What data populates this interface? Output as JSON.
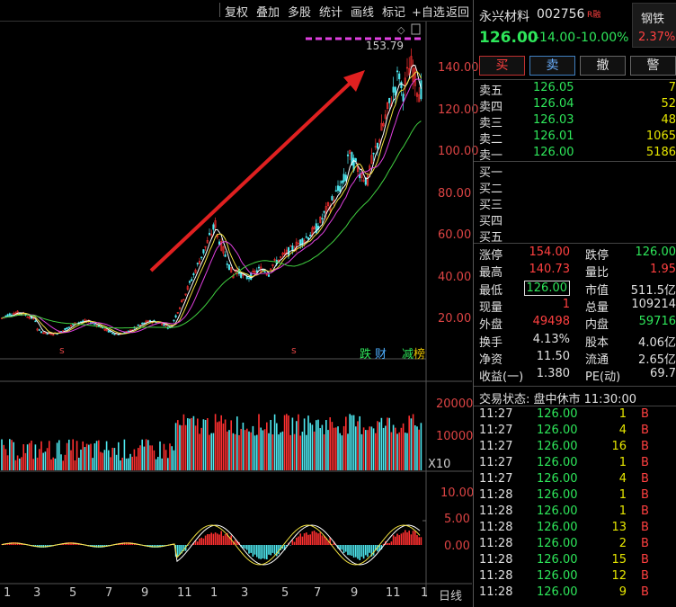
{
  "toolbar": {
    "items": [
      "复权",
      "叠加",
      "多股",
      "统计",
      "画线",
      "标记",
      "+自选",
      "返回"
    ]
  },
  "chart": {
    "price_axis": [
      "140.00",
      "120.00",
      "100.00",
      "80.00",
      "60.00",
      "40.00",
      "20.00"
    ],
    "peak_label": "153.79",
    "markers": [
      "跌",
      "财",
      "减",
      "榜"
    ],
    "s_marks": [
      "s",
      "s"
    ],
    "vol_axis": [
      "20000",
      "10000",
      "X10"
    ],
    "macd_axis": [
      "10.00",
      "5.00",
      "0.00"
    ],
    "month_labels": [
      "1",
      "3",
      "5",
      "7",
      "9",
      "11",
      "1",
      "3",
      "5",
      "7",
      "9",
      "11",
      "1"
    ],
    "period": "日线",
    "colors": {
      "up": "#ff3030",
      "down": "#4ee8f0",
      "ma_white": "#ffffff",
      "ma_yellow": "#f0e040",
      "ma_purple": "#e040e0",
      "ma_green": "#40d040",
      "arrow": "#e02020"
    }
  },
  "panel": {
    "name": "永兴材料",
    "code": "002756",
    "badge": "R融",
    "sector": "钢铁",
    "price": "126.00",
    "change": "-14.00",
    "change_pct": "-10.00%",
    "sector_pct": "2.37%",
    "tabs": [
      "买",
      "卖",
      "撤",
      "警"
    ],
    "sells": [
      {
        "label": "卖五",
        "price": "126.05",
        "vol": "7"
      },
      {
        "label": "卖四",
        "price": "126.04",
        "vol": "52"
      },
      {
        "label": "卖三",
        "price": "126.03",
        "vol": "48"
      },
      {
        "label": "卖二",
        "price": "126.01",
        "vol": "1065"
      },
      {
        "label": "卖一",
        "price": "126.00",
        "vol": "5186"
      }
    ],
    "buys": [
      "买一",
      "买二",
      "买三",
      "买四",
      "买五"
    ],
    "stats": [
      {
        "l1": "涨停",
        "v1": "154.00",
        "l2": "跌停",
        "v2": "126.00"
      },
      {
        "l1": "最高",
        "v1": "140.73",
        "l2": "量比",
        "v2": "1.95"
      },
      {
        "l1": "最低",
        "v1": "126.00",
        "l2": "市值",
        "v2": "511.5亿"
      },
      {
        "l1": "现量",
        "v1": "1",
        "l2": "总量",
        "v2": "109214"
      },
      {
        "l1": "外盘",
        "v1": "49498",
        "l2": "内盘",
        "v2": "59716"
      },
      {
        "l1": "换手",
        "v1": "4.13%",
        "l2": "股本",
        "v2": "4.06亿"
      },
      {
        "l1": "净资",
        "v1": "11.50",
        "l2": "流通",
        "v2": "2.65亿"
      },
      {
        "l1": "收益(一)",
        "v1": "1.380",
        "l2": "PE(动)",
        "v2": "69.7"
      }
    ],
    "trade_status": "交易状态: 盘中休市 11:30:00",
    "ticks": [
      {
        "time": "11:27",
        "price": "126.00",
        "vol": "1",
        "side": "B"
      },
      {
        "time": "11:27",
        "price": "126.00",
        "vol": "4",
        "side": "B"
      },
      {
        "time": "11:27",
        "price": "126.00",
        "vol": "16",
        "side": "B"
      },
      {
        "time": "11:27",
        "price": "126.00",
        "vol": "1",
        "side": "B"
      },
      {
        "time": "11:27",
        "price": "126.00",
        "vol": "4",
        "side": "B"
      },
      {
        "time": "11:28",
        "price": "126.00",
        "vol": "1",
        "side": "B"
      },
      {
        "time": "11:28",
        "price": "126.00",
        "vol": "1",
        "side": "B"
      },
      {
        "time": "11:28",
        "price": "126.00",
        "vol": "13",
        "side": "B"
      },
      {
        "time": "11:28",
        "price": "126.00",
        "vol": "2",
        "side": "B"
      },
      {
        "time": "11:28",
        "price": "126.00",
        "vol": "15",
        "side": "B"
      },
      {
        "time": "11:28",
        "price": "126.00",
        "vol": "12",
        "side": "B"
      },
      {
        "time": "11:28",
        "price": "126.00",
        "vol": "9",
        "side": "B"
      }
    ]
  }
}
